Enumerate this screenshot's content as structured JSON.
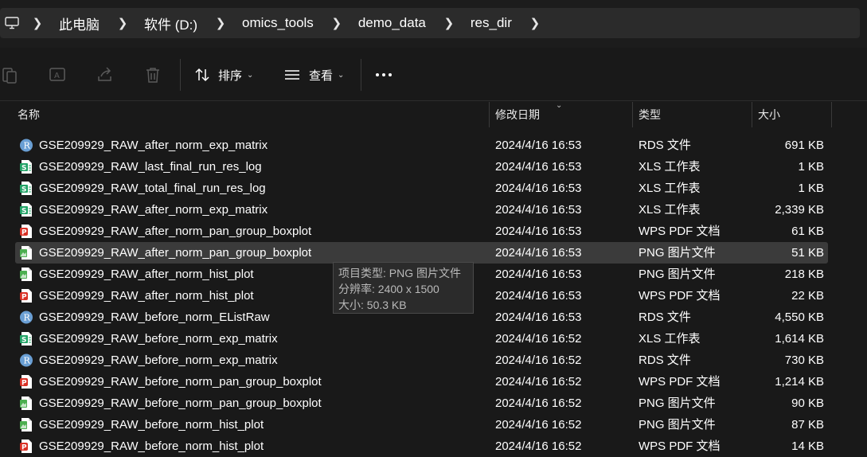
{
  "breadcrumb": [
    "此电脑",
    "软件 (D:)",
    "omics_tools",
    "demo_data",
    "res_dir"
  ],
  "toolbar": {
    "sort_label": "排序",
    "view_label": "查看"
  },
  "columns": {
    "name": "名称",
    "date": "修改日期",
    "type": "类型",
    "size": "大小"
  },
  "files": [
    {
      "name": "GSE209929_RAW_after_norm_exp_matrix",
      "date": "2024/4/16 16:53",
      "type": "RDS 文件",
      "size": "691 KB",
      "icon": "rds-file-icon"
    },
    {
      "name": "GSE209929_RAW_last_final_run_res_log",
      "date": "2024/4/16 16:53",
      "type": "XLS 工作表",
      "size": "1 KB",
      "icon": "xls-file-icon"
    },
    {
      "name": "GSE209929_RAW_total_final_run_res_log",
      "date": "2024/4/16 16:53",
      "type": "XLS 工作表",
      "size": "1 KB",
      "icon": "xls-file-icon"
    },
    {
      "name": "GSE209929_RAW_after_norm_exp_matrix",
      "date": "2024/4/16 16:53",
      "type": "XLS 工作表",
      "size": "2,339 KB",
      "icon": "xls-file-icon"
    },
    {
      "name": "GSE209929_RAW_after_norm_pan_group_boxplot",
      "date": "2024/4/16 16:53",
      "type": "WPS PDF 文档",
      "size": "61 KB",
      "icon": "pdf-file-icon"
    },
    {
      "name": "GSE209929_RAW_after_norm_pan_group_boxplot",
      "date": "2024/4/16 16:53",
      "type": "PNG 图片文件",
      "size": "51 KB",
      "icon": "png-file-icon",
      "selected": true
    },
    {
      "name": "GSE209929_RAW_after_norm_hist_plot",
      "date": "2024/4/16 16:53",
      "type": "PNG 图片文件",
      "size": "218 KB",
      "icon": "png-file-icon"
    },
    {
      "name": "GSE209929_RAW_after_norm_hist_plot",
      "date": "2024/4/16 16:53",
      "type": "WPS PDF 文档",
      "size": "22 KB",
      "icon": "pdf-file-icon"
    },
    {
      "name": "GSE209929_RAW_before_norm_EListRaw",
      "date": "2024/4/16 16:53",
      "type": "RDS 文件",
      "size": "4,550 KB",
      "icon": "rds-file-icon"
    },
    {
      "name": "GSE209929_RAW_before_norm_exp_matrix",
      "date": "2024/4/16 16:52",
      "type": "XLS 工作表",
      "size": "1,614 KB",
      "icon": "xls-file-icon"
    },
    {
      "name": "GSE209929_RAW_before_norm_exp_matrix",
      "date": "2024/4/16 16:52",
      "type": "RDS 文件",
      "size": "730 KB",
      "icon": "rds-file-icon"
    },
    {
      "name": "GSE209929_RAW_before_norm_pan_group_boxplot",
      "date": "2024/4/16 16:52",
      "type": "WPS PDF 文档",
      "size": "1,214 KB",
      "icon": "pdf-file-icon"
    },
    {
      "name": "GSE209929_RAW_before_norm_pan_group_boxplot",
      "date": "2024/4/16 16:52",
      "type": "PNG 图片文件",
      "size": "90 KB",
      "icon": "png-file-icon"
    },
    {
      "name": "GSE209929_RAW_before_norm_hist_plot",
      "date": "2024/4/16 16:52",
      "type": "PNG 图片文件",
      "size": "87 KB",
      "icon": "png-file-icon"
    },
    {
      "name": "GSE209929_RAW_before_norm_hist_plot",
      "date": "2024/4/16 16:52",
      "type": "WPS PDF 文档",
      "size": "14 KB",
      "icon": "pdf-file-icon"
    }
  ],
  "tooltip": {
    "line1": "项目类型: PNG 图片文件",
    "line2": "分辨率: 2400 x 1500",
    "line3": "大小: 50.3 KB"
  },
  "colors": {
    "rds": "#6a9fd4",
    "xls": "#21a366",
    "pdf": "#d93025",
    "png": "#4caf50"
  }
}
